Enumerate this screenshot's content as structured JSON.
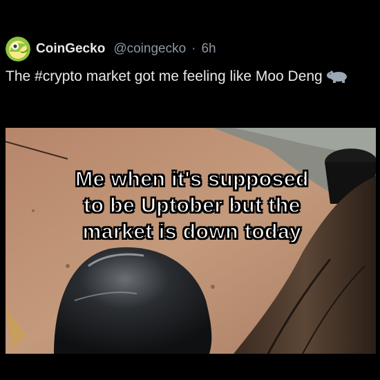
{
  "post": {
    "author_name": "CoinGecko",
    "author_handle": "@coingecko",
    "separator": "·",
    "time": "6h",
    "text_prefix": "The ",
    "hashtag": "#crypto",
    "text_suffix": " market got me feeling like Moo Deng",
    "emoji": "hippo-icon"
  },
  "media": {
    "caption_lines": [
      "Me when it's supposed",
      "to be Uptober but the",
      "market is down today"
    ]
  },
  "colors": {
    "background": "#000000",
    "text": "#e7e9ea",
    "secondary_text": "#8b98a5",
    "avatar_green": "#8dc63f"
  }
}
